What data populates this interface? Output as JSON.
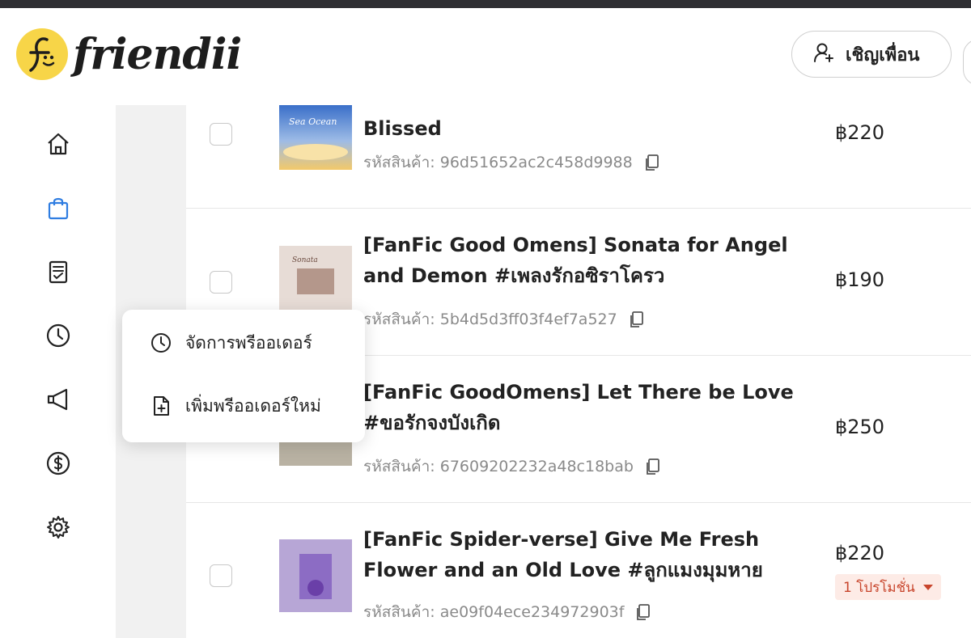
{
  "app": {
    "name": "friendii",
    "brand_color": "#f7d548",
    "active_color": "#2f7de1"
  },
  "header": {
    "invite_label": "เชิญเพื่อน",
    "invite_icon": "add-user-icon"
  },
  "sidebar": {
    "items": [
      {
        "name": "home",
        "icon": "home-icon"
      },
      {
        "name": "shop",
        "icon": "shopping-bag-icon",
        "active": true
      },
      {
        "name": "orders",
        "icon": "receipt-icon"
      },
      {
        "name": "preorders",
        "icon": "clock-icon"
      },
      {
        "name": "marketing",
        "icon": "megaphone-icon"
      },
      {
        "name": "finance",
        "icon": "dollar-icon"
      },
      {
        "name": "settings",
        "icon": "gear-icon"
      }
    ]
  },
  "products": [
    {
      "title": "Blissed",
      "sku_label": "รหัสสินค้า:",
      "sku": "96d51652ac2c458d9988",
      "price": "฿220"
    },
    {
      "title": "[FanFic Good Omens] Sonata for Angel and Demon #เพลงรักอซิราโครว",
      "sku_label": "รหัสสินค้า:",
      "sku": "5b4d5d3ff03f4ef7a527",
      "price": "฿190"
    },
    {
      "title": "[FanFic GoodOmens] Let There be Love #ขอรักจงบังเกิด",
      "sku_label": "รหัสสินค้า:",
      "sku": "67609202232a48c18bab",
      "price": "฿250"
    },
    {
      "title": "[FanFic Spider-verse] Give Me Fresh Flower and an Old Love #ลูกแมงมุมหาย",
      "sku_label": "รหัสสินค้า:",
      "sku": "ae09f04ece234972903f",
      "price": "฿220",
      "promo": "1 โปรโมชั่น"
    }
  ],
  "popup": {
    "items": [
      {
        "label": "จัดการพรีออเดอร์",
        "icon": "clock-icon"
      },
      {
        "label": "เพิ่มพรีออเดอร์ใหม่",
        "icon": "add-file-icon"
      }
    ]
  }
}
